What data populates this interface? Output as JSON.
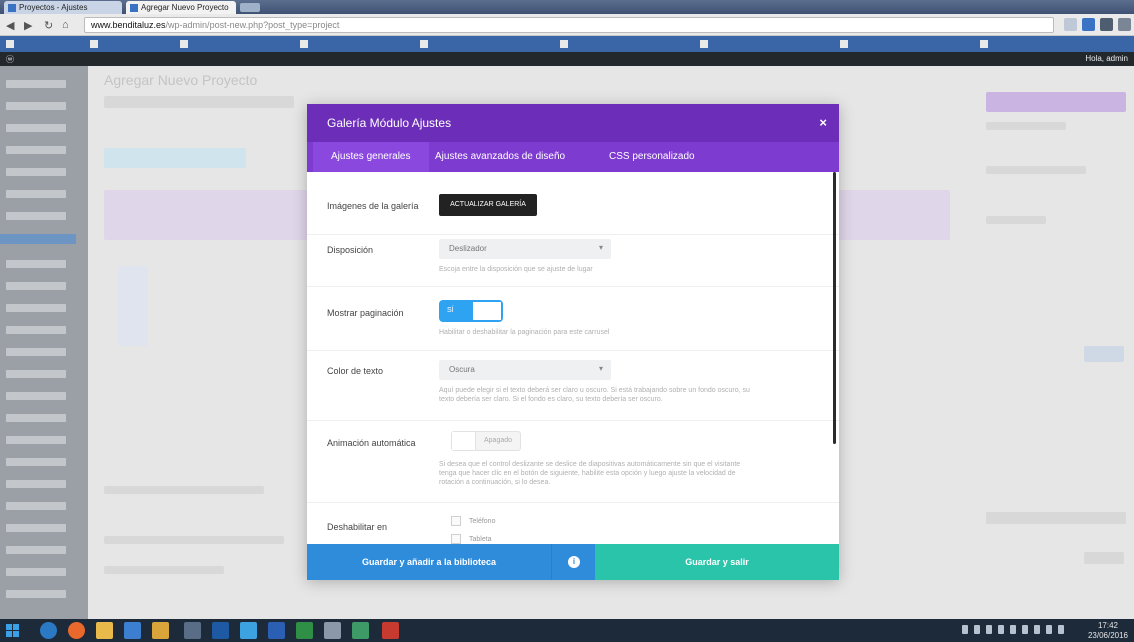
{
  "browser": {
    "tabs": [
      {
        "label": "Proyectos - Ajustes"
      },
      {
        "label": "Agregar Nuevo Proyecto"
      }
    ],
    "address": {
      "host": "www.benditaluz.es",
      "path": "/wp-admin/post-new.php?post_type=project"
    }
  },
  "wp": {
    "page_title": "Agregar Nuevo Proyecto",
    "adminbar_right": "Hola, admin"
  },
  "modal": {
    "title": "Galería Módulo Ajustes",
    "close_symbol": "×",
    "tabs": [
      {
        "label": "Ajustes generales"
      },
      {
        "label": "Ajustes avanzados de diseño"
      },
      {
        "label": "CSS personalizado"
      }
    ],
    "gallery_images": {
      "label": "Imágenes de la galería",
      "button": "ACTUALIZAR GALERÍA"
    },
    "layout": {
      "label": "Disposición",
      "value": "Deslizador",
      "help": "Escoja entre la disposición que se ajuste de lugar"
    },
    "pagination": {
      "label": "Mostrar paginación",
      "value": "SÍ",
      "help": "Habilitar o deshabilitar la paginación para este carrusel"
    },
    "text_color": {
      "label": "Color de texto",
      "value": "Oscura",
      "help": "Aquí puede elegir si el texto deberá ser claro u oscuro. Si está trabajando sobre un fondo oscuro, su texto debería ser claro. Si el fondo es claro, su texto debería ser oscuro."
    },
    "autoplay": {
      "label": "Animación automática",
      "value": "Apagado",
      "help": "Si desea que el control deslizante se deslice de diapositivas automáticamente sin que el visitante tenga que hacer clic en el botón de siguiente, habilite esta opción y luego ajuste la velocidad de rotación a continuación, si lo desea."
    },
    "disable_on": {
      "label": "Deshabilitar en",
      "options": [
        {
          "label": "Teléfono"
        },
        {
          "label": "Tableta"
        }
      ]
    },
    "footer": {
      "save_library": "Guardar y añadir a la biblioteca",
      "info_symbol": "i",
      "save_exit": "Guardar y salir"
    }
  },
  "taskbar": {
    "time": "17:42",
    "date": "23/06/2016"
  }
}
